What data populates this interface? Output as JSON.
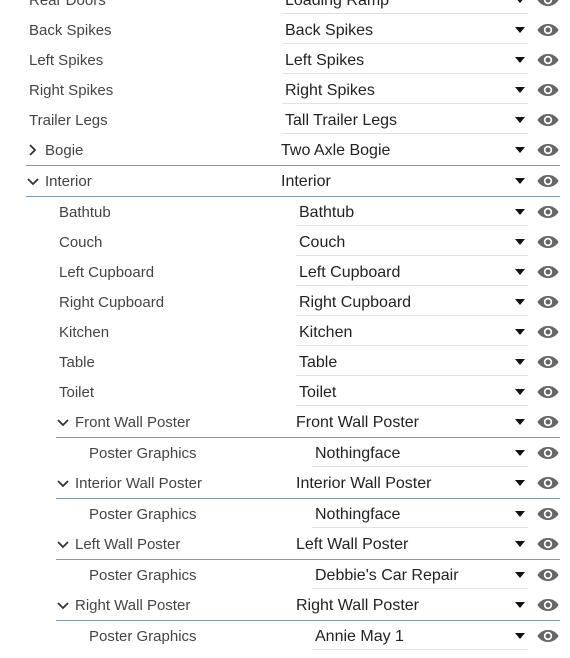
{
  "rows": [
    {
      "label": "Rear Doors",
      "value": "Loading Ramp",
      "level": 0,
      "kind": "item"
    },
    {
      "label": "Back Spikes",
      "value": "Back Spikes",
      "level": 0,
      "kind": "item"
    },
    {
      "label": "Left Spikes",
      "value": "Left Spikes",
      "level": 0,
      "kind": "item"
    },
    {
      "label": "Right Spikes",
      "value": "Right Spikes",
      "level": 0,
      "kind": "item"
    },
    {
      "label": "Trailer Legs",
      "value": "Tall Trailer Legs",
      "level": 0,
      "kind": "item"
    },
    {
      "label": "Bogie",
      "value": "Two Axle Bogie",
      "level": 0,
      "kind": "group",
      "expanded": false
    },
    {
      "label": "Interior",
      "value": "Interior",
      "level": 0,
      "kind": "group",
      "expanded": true
    },
    {
      "label": "Bathtub",
      "value": "Bathtub",
      "level": 1,
      "kind": "item"
    },
    {
      "label": "Couch",
      "value": "Couch",
      "level": 1,
      "kind": "item"
    },
    {
      "label": "Left Cupboard",
      "value": "Left Cupboard",
      "level": 1,
      "kind": "item"
    },
    {
      "label": "Right Cupboard",
      "value": "Right Cupboard",
      "level": 1,
      "kind": "item"
    },
    {
      "label": "Kitchen",
      "value": "Kitchen",
      "level": 1,
      "kind": "item"
    },
    {
      "label": "Table",
      "value": "Table",
      "level": 1,
      "kind": "item"
    },
    {
      "label": "Toilet",
      "value": "Toilet",
      "level": 1,
      "kind": "item"
    },
    {
      "label": "Front Wall Poster",
      "value": "Front Wall Poster",
      "level": 1,
      "kind": "group",
      "expanded": true
    },
    {
      "label": "Poster Graphics",
      "value": "Nothingface",
      "level": 2,
      "kind": "item"
    },
    {
      "label": "Interior Wall Poster",
      "value": "Interior Wall Poster",
      "level": 1,
      "kind": "group",
      "expanded": true
    },
    {
      "label": "Poster Graphics",
      "value": "Nothingface",
      "level": 2,
      "kind": "item"
    },
    {
      "label": "Left Wall Poster",
      "value": "Left Wall Poster",
      "level": 1,
      "kind": "group",
      "expanded": true
    },
    {
      "label": "Poster Graphics",
      "value": "Debbie's Car Repair",
      "level": 2,
      "kind": "item"
    },
    {
      "label": "Right Wall Poster",
      "value": "Right Wall Poster",
      "level": 1,
      "kind": "group",
      "expanded": true
    },
    {
      "label": "Poster Graphics",
      "value": "Annie May 1",
      "level": 2,
      "kind": "item"
    }
  ],
  "icons": {
    "visibility": "eye-icon",
    "dropdown": "dropdown-arrow-icon",
    "collapsed": "chevron-right-icon",
    "expanded": "chevron-down-icon"
  },
  "colors": {
    "icon": "#666666",
    "group_divider": "#7f9aa8",
    "select_underline": "#e2e2e2"
  }
}
